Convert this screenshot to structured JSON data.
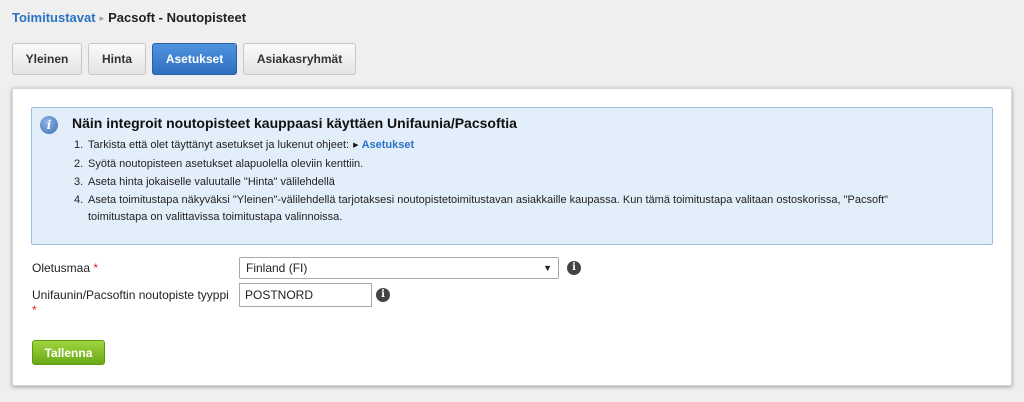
{
  "breadcrumb": {
    "parent": "Toimitustavat",
    "separator": "▸",
    "current": "Pacsoft - Noutopisteet"
  },
  "tabs": [
    {
      "label": "Yleinen",
      "active": false
    },
    {
      "label": "Hinta",
      "active": false
    },
    {
      "label": "Asetukset",
      "active": true
    },
    {
      "label": "Asiakasryhmät",
      "active": false
    }
  ],
  "info": {
    "icon": "info-icon",
    "title": "Näin integroit noutopisteet kauppaasi käyttäen Unifaunia/Pacsoftia",
    "steps": [
      {
        "num": "1.",
        "text": "Tarkista että olet täyttänyt asetukset ja lukenut ohjeet:",
        "link": "Asetukset"
      },
      {
        "num": "2.",
        "text": "Syötä noutopisteen asetukset alapuolella oleviin kenttiin."
      },
      {
        "num": "3.",
        "text": "Aseta hinta jokaiselle valuutalle \"Hinta\" välilehdellä"
      },
      {
        "num": "4.",
        "text": "Aseta toimitustapa näkyväksi \"Yleinen\"-välilehdellä tarjotaksesi noutopistetoimitustavan asiakkaille kaupassa. Kun tämä toimitustapa valitaan ostoskorissa, \"Pacsoft\"",
        "text2": "toimitustapa on valittavissa toimitustapa valinnoissa."
      }
    ]
  },
  "form": {
    "country": {
      "label": "Oletusmaa",
      "required_mark": "*",
      "value": "Finland (FI)"
    },
    "pickup_type": {
      "label": "Unifaunin/Pacsoftin noutopiste tyyppi",
      "required_mark": "*",
      "value": "POSTNORD"
    }
  },
  "save_label": "Tallenna",
  "colors": {
    "accent": "#2f6fc0",
    "save": "#7bb523",
    "info_bg": "#e3eefb"
  }
}
